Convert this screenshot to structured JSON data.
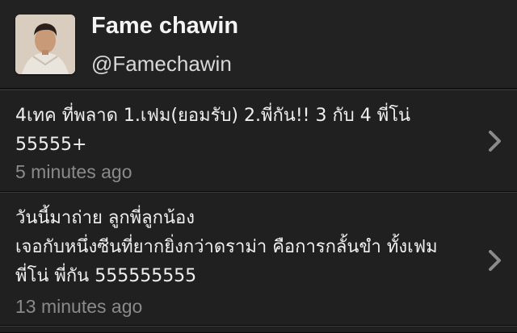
{
  "profile": {
    "display_name": "Fame chawin",
    "handle": "@Famechawin"
  },
  "tweets": [
    {
      "text": "4เทค ที่พลาด 1.เฟม(ยอมรับ) 2.พี่กัน!! 3 กับ 4 พี่โน่\n55555+",
      "time": "5 minutes ago"
    },
    {
      "text": "วันนี้มาถ่าย ลูกพี่ลูกน้อง\nเจอกับหนึ่งซีนที่ยากยิ่งกว่าดราม่า คือการกลั้นขำ ทั้งเฟม\nพี่โน่ พี่กัน 555555555",
      "time": "13 minutes ago"
    }
  ],
  "icons": {
    "row_chevron": "chevron-right-icon",
    "avatar": "profile-photo"
  },
  "colors": {
    "background": "#1f1f1f",
    "text": "#efefef",
    "muted": "#8a8a8a"
  }
}
